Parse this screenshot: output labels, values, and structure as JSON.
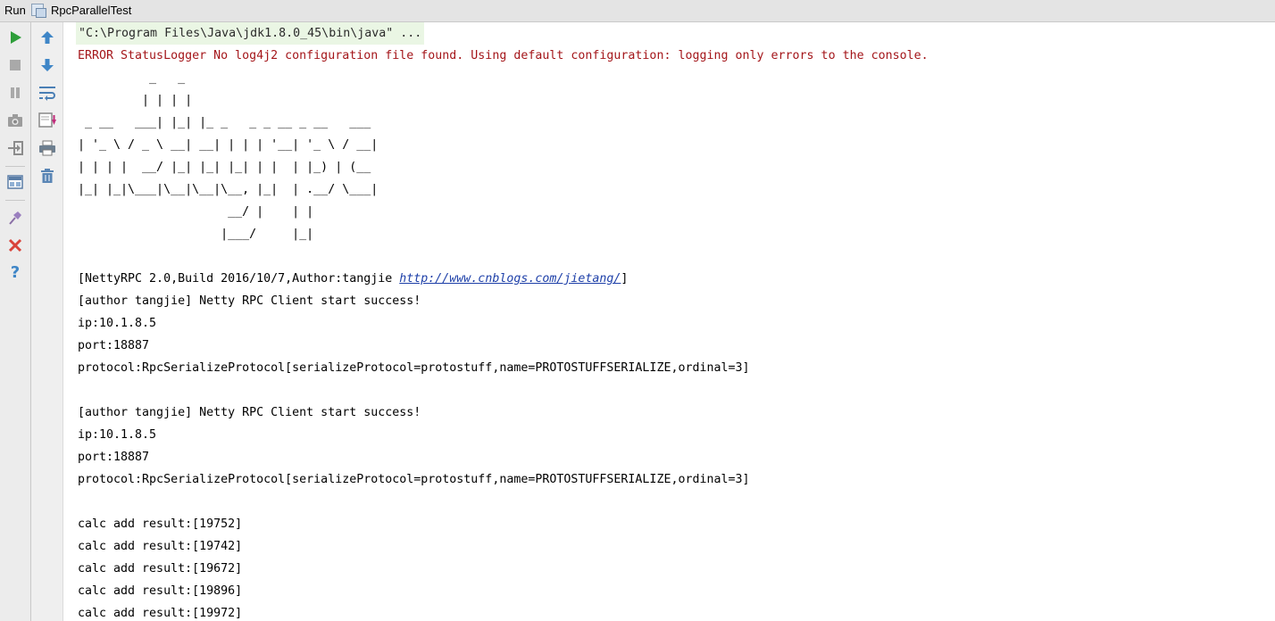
{
  "tool_window": {
    "run_label": "Run",
    "tab_name": "RpcParallelTest"
  },
  "toolbar_left": [
    {
      "icon": "play-icon"
    },
    {
      "icon": "stop-icon"
    },
    {
      "icon": "pause-icon"
    },
    {
      "icon": "camera-icon"
    },
    {
      "icon": "exit-icon"
    },
    {
      "icon": "layout-icon"
    },
    {
      "icon": "pin-icon"
    },
    {
      "icon": "close-icon"
    },
    {
      "icon": "help-icon"
    }
  ],
  "toolbar_right": [
    {
      "icon": "up-arrow-icon"
    },
    {
      "icon": "down-arrow-icon"
    },
    {
      "icon": "soft-wrap-icon"
    },
    {
      "icon": "scroll-to-end-icon"
    },
    {
      "icon": "print-icon"
    },
    {
      "icon": "trash-icon"
    }
  ],
  "console": {
    "command": "\"C:\\Program Files\\Java\\jdk1.8.0_45\\bin\\java\" ...",
    "error": "ERROR StatusLogger No log4j2 configuration file found. Using default configuration: logging only errors to the console.",
    "banner": [
      "          _   _",
      "         | | | |",
      " _ __   ___| |_| |_ _   _ _ __ _ __   ___",
      "| '_ \\ / _ \\ __| __| | | | '__| '_ \\ / __|",
      "| | | |  __/ |_| |_| |_| | |  | |_) | (__",
      "|_| |_|\\___|\\__|\\__|\\__, |_|  | .__/ \\___|",
      "                     __/ |    | |",
      "                    |___/     |_|"
    ],
    "info_prefix": "[NettyRPC 2.0,Build 2016/10/7,Author:tangjie ",
    "info_link": "http://www.cnblogs.com/jietang/",
    "info_suffix": "]",
    "client1": {
      "start": "[author tangjie] Netty RPC Client start success!",
      "ip": "ip:10.1.8.5",
      "port": "port:18887",
      "protocol": "protocol:RpcSerializeProtocol[serializeProtocol=protostuff,name=PROTOSTUFFSERIALIZE,ordinal=3]"
    },
    "client2": {
      "start": "[author tangjie] Netty RPC Client start success!",
      "ip": "ip:10.1.8.5",
      "port": "port:18887",
      "protocol": "protocol:RpcSerializeProtocol[serializeProtocol=protostuff,name=PROTOSTUFFSERIALIZE,ordinal=3]"
    },
    "results": [
      "calc add result:[19752]",
      "calc add result:[19742]",
      "calc add result:[19672]",
      "calc add result:[19896]",
      "calc add result:[19972]"
    ]
  },
  "colors": {
    "error": "#a4161a",
    "link": "#1d3fa8",
    "command_bg": "#eaf6e4",
    "run_green": "#2e9e3a",
    "close_red": "#d9433a",
    "arrow_blue": "#3f86c7"
  }
}
